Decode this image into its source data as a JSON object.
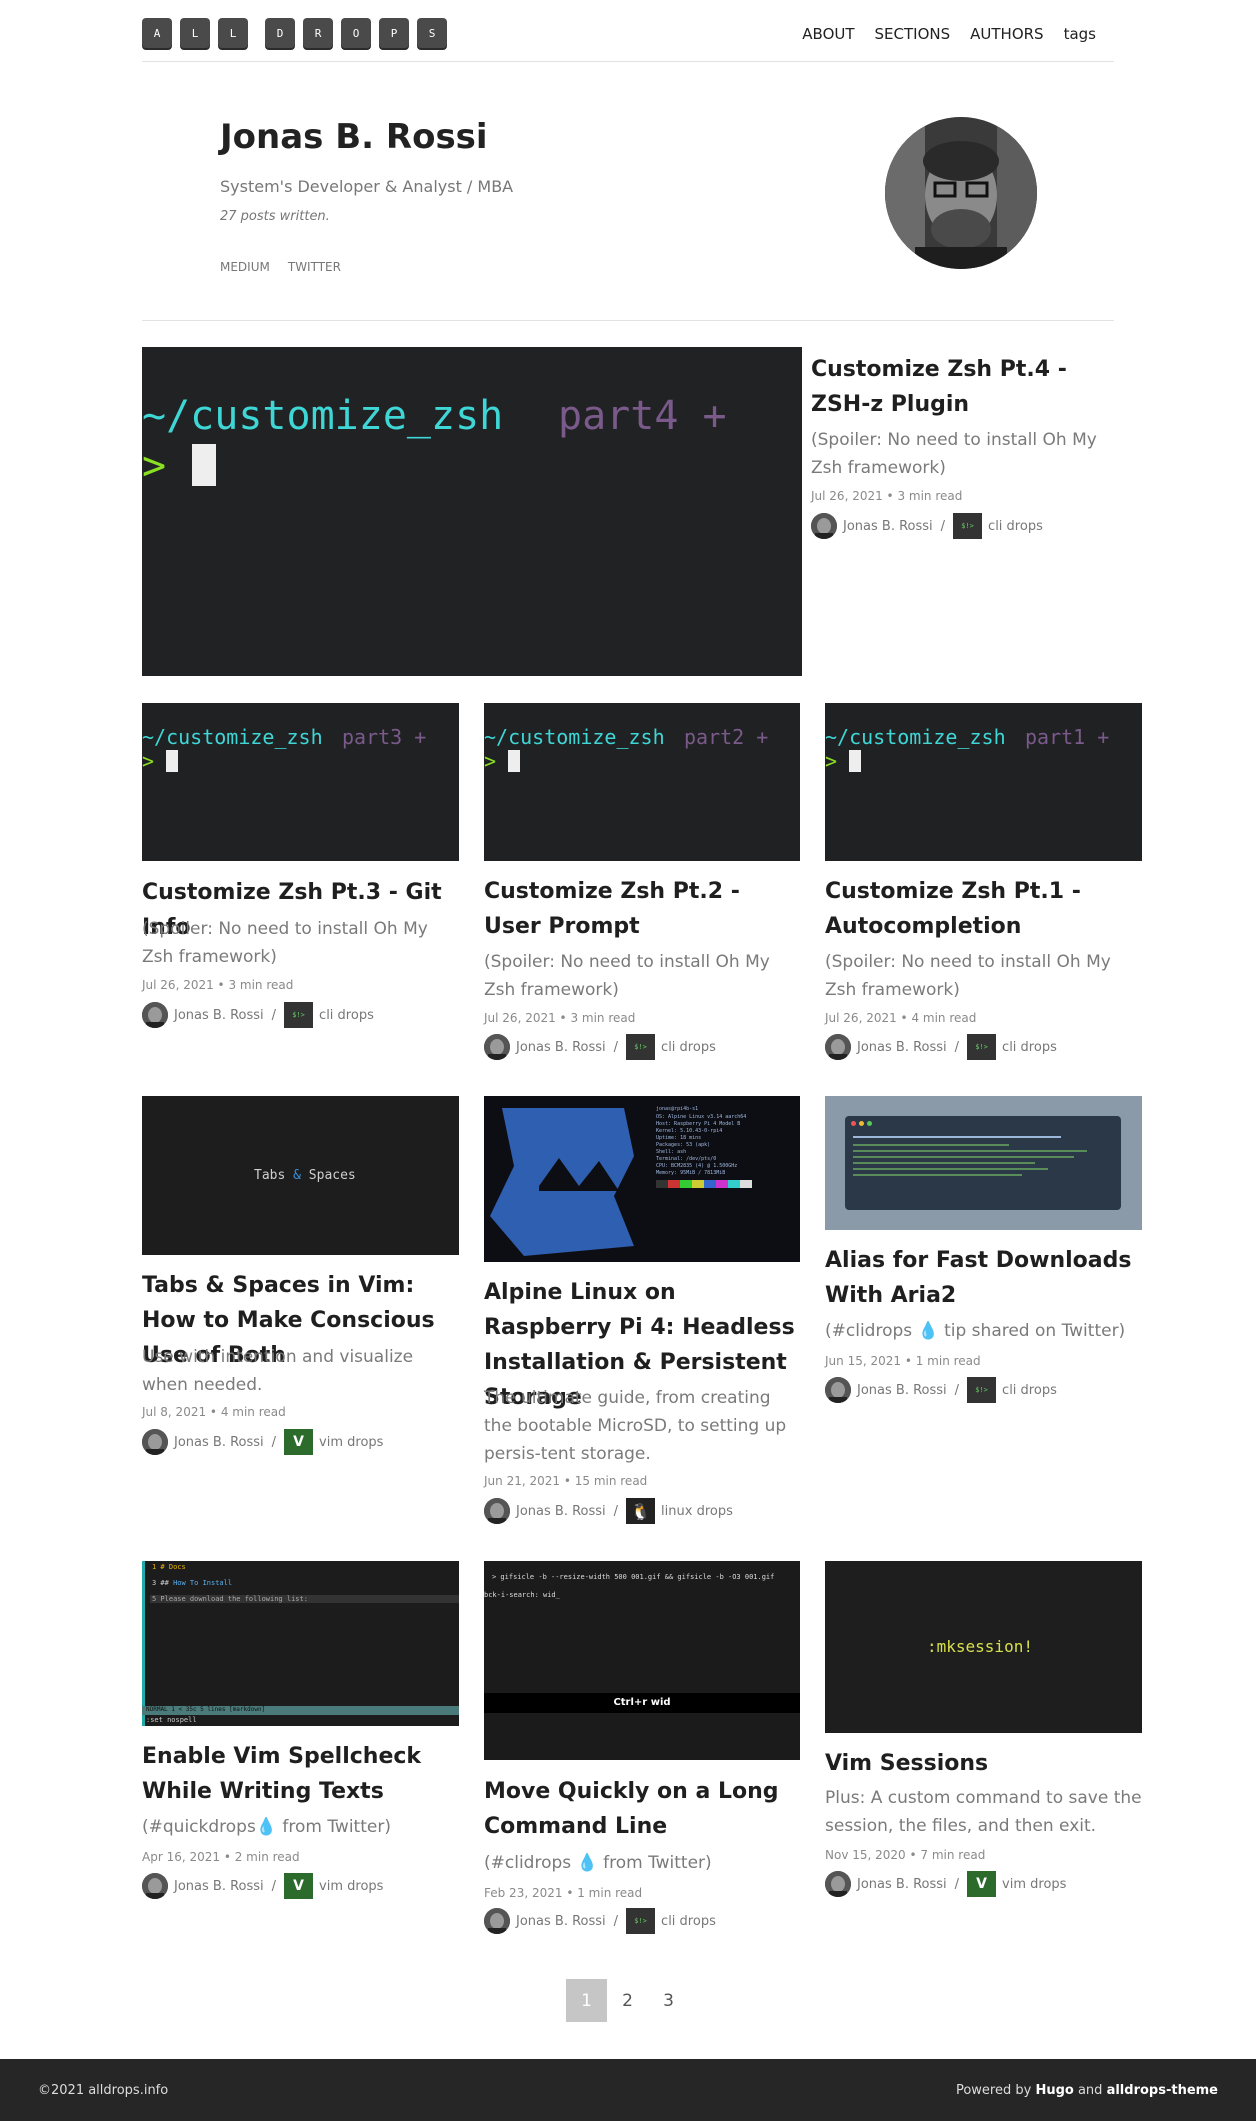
{
  "logo": [
    "A",
    "L",
    "L",
    "D",
    "R",
    "O",
    "P",
    "S"
  ],
  "nav": [
    "ABOUT",
    "SECTIONS",
    "AUTHORS",
    "tags"
  ],
  "author": {
    "name": "Jonas B. Rossi",
    "role": "System's Developer & Analyst / MBA",
    "count": "27 posts written.",
    "links": [
      "MEDIUM",
      "TWITTER"
    ]
  },
  "posts": [
    {
      "title": "Customize Zsh Pt.4 - ZSH-z Plugin",
      "sub": "(Spoiler: No need to install Oh My Zsh framework)",
      "date": "Jul 26, 2021",
      "read": "3  min read",
      "author": "Jonas B. Rossi",
      "section": "cli drops",
      "thumb_cmd": "~/customize_zsh",
      "thumb_part": "part4 +"
    },
    {
      "title": "Customize Zsh Pt.3 - Git Info",
      "sub": "(Spoiler: No need to install Oh My Zsh framework)",
      "date": "Jul 26, 2021",
      "read": "3  min read",
      "author": "Jonas B. Rossi",
      "section": "cli drops",
      "thumb_cmd": "~/customize_zsh",
      "thumb_part": "part3 +"
    },
    {
      "title": "Customize Zsh Pt.2 - User Prompt",
      "sub": "(Spoiler: No need to install Oh My Zsh framework)",
      "date": "Jul 26, 2021",
      "read": "3  min read",
      "author": "Jonas B. Rossi",
      "section": "cli drops",
      "thumb_cmd": "~/customize_zsh",
      "thumb_part": "part2 +"
    },
    {
      "title": "Customize Zsh Pt.1 - Autocompletion",
      "sub": "(Spoiler: No need to install Oh My Zsh framework)",
      "date": "Jul 26, 2021",
      "read": "4  min read",
      "author": "Jonas B. Rossi",
      "section": "cli drops",
      "thumb_cmd": "~/customize_zsh",
      "thumb_part": "part1 +"
    },
    {
      "title": "Tabs & Spaces in Vim: How to Make Conscious Use of Both",
      "sub": "Use with intention and visualize when needed.",
      "date": "Jul 8, 2021",
      "read": "4  min read",
      "author": "Jonas B. Rossi",
      "section": "vim drops",
      "thumb_a": "Tabs",
      "thumb_b": "&",
      "thumb_c": "Spaces"
    },
    {
      "title": "Alpine Linux on Raspberry Pi 4: Headless Installation & Persistent Storage",
      "sub": "The ultimate guide, from creating the bootable MicroSD, to setting up persis-tent storage.",
      "date": "Jun 21, 2021",
      "read": "15  min read",
      "author": "Jonas B. Rossi",
      "section": "linux drops"
    },
    {
      "title": "Alias for Fast Downloads With Aria2",
      "sub": "(#clidrops 💧 tip shared on Twitter)",
      "date": "Jun 15, 2021",
      "read": "1  min read",
      "author": "Jonas B. Rossi",
      "section": "cli drops"
    },
    {
      "title": "Enable Vim Spellcheck While Writing Texts",
      "sub": "(#quickdrops💧 from Twitter)",
      "date": "Apr 16, 2021",
      "read": "2  min read",
      "author": "Jonas B. Rossi",
      "section": "vim drops"
    },
    {
      "title": "Move Quickly on a Long Command Line",
      "sub": "(#clidrops 💧 from Twitter)",
      "date": "Feb 23, 2021",
      "read": "1  min read",
      "author": "Jonas B. Rossi",
      "section": "cli drops",
      "thumb_cmd": "> gifsicle -b --resize-width 500 001.gif && gifsicle -b -O3 001.gif",
      "thumb_search": "bck-i-search: wid_",
      "thumb_caption": "Ctrl+r wid"
    },
    {
      "title": "Vim Sessions",
      "sub": "Plus: A custom command to save the session, the files, and then exit.",
      "date": "Nov 15, 2020",
      "read": "7  min read",
      "author": "Jonas B. Rossi",
      "section": "vim drops",
      "thumb_cmd": ":mksession!"
    }
  ],
  "pager": [
    "1",
    "2",
    "3"
  ],
  "footer": {
    "copy": "©2021 alldrops.info",
    "powered": "Powered by",
    "hugo": "Hugo",
    "and": "and",
    "theme": "alldrops-theme"
  }
}
